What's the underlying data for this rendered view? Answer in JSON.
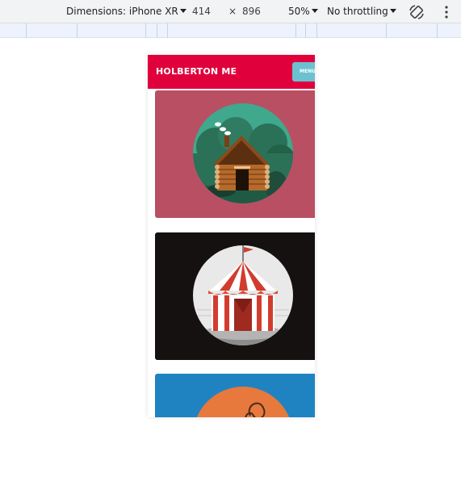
{
  "devtools": {
    "dimensions_label": "Dimensions: iPhone XR",
    "width": "414",
    "times": "×",
    "height": "896",
    "zoom": "50%",
    "throttling": "No throttling"
  },
  "app": {
    "brand": "HOLBERTON ME",
    "menu_label": "MENU"
  },
  "cards": [
    {
      "name": "log-cabin",
      "background": "#b94f63"
    },
    {
      "name": "circus-tent",
      "background": "#141110"
    },
    {
      "name": "orange-circle",
      "background": "#1f83c1"
    }
  ],
  "colors": {
    "header": "#e0003c",
    "menu_button": "#6cc1d0"
  }
}
